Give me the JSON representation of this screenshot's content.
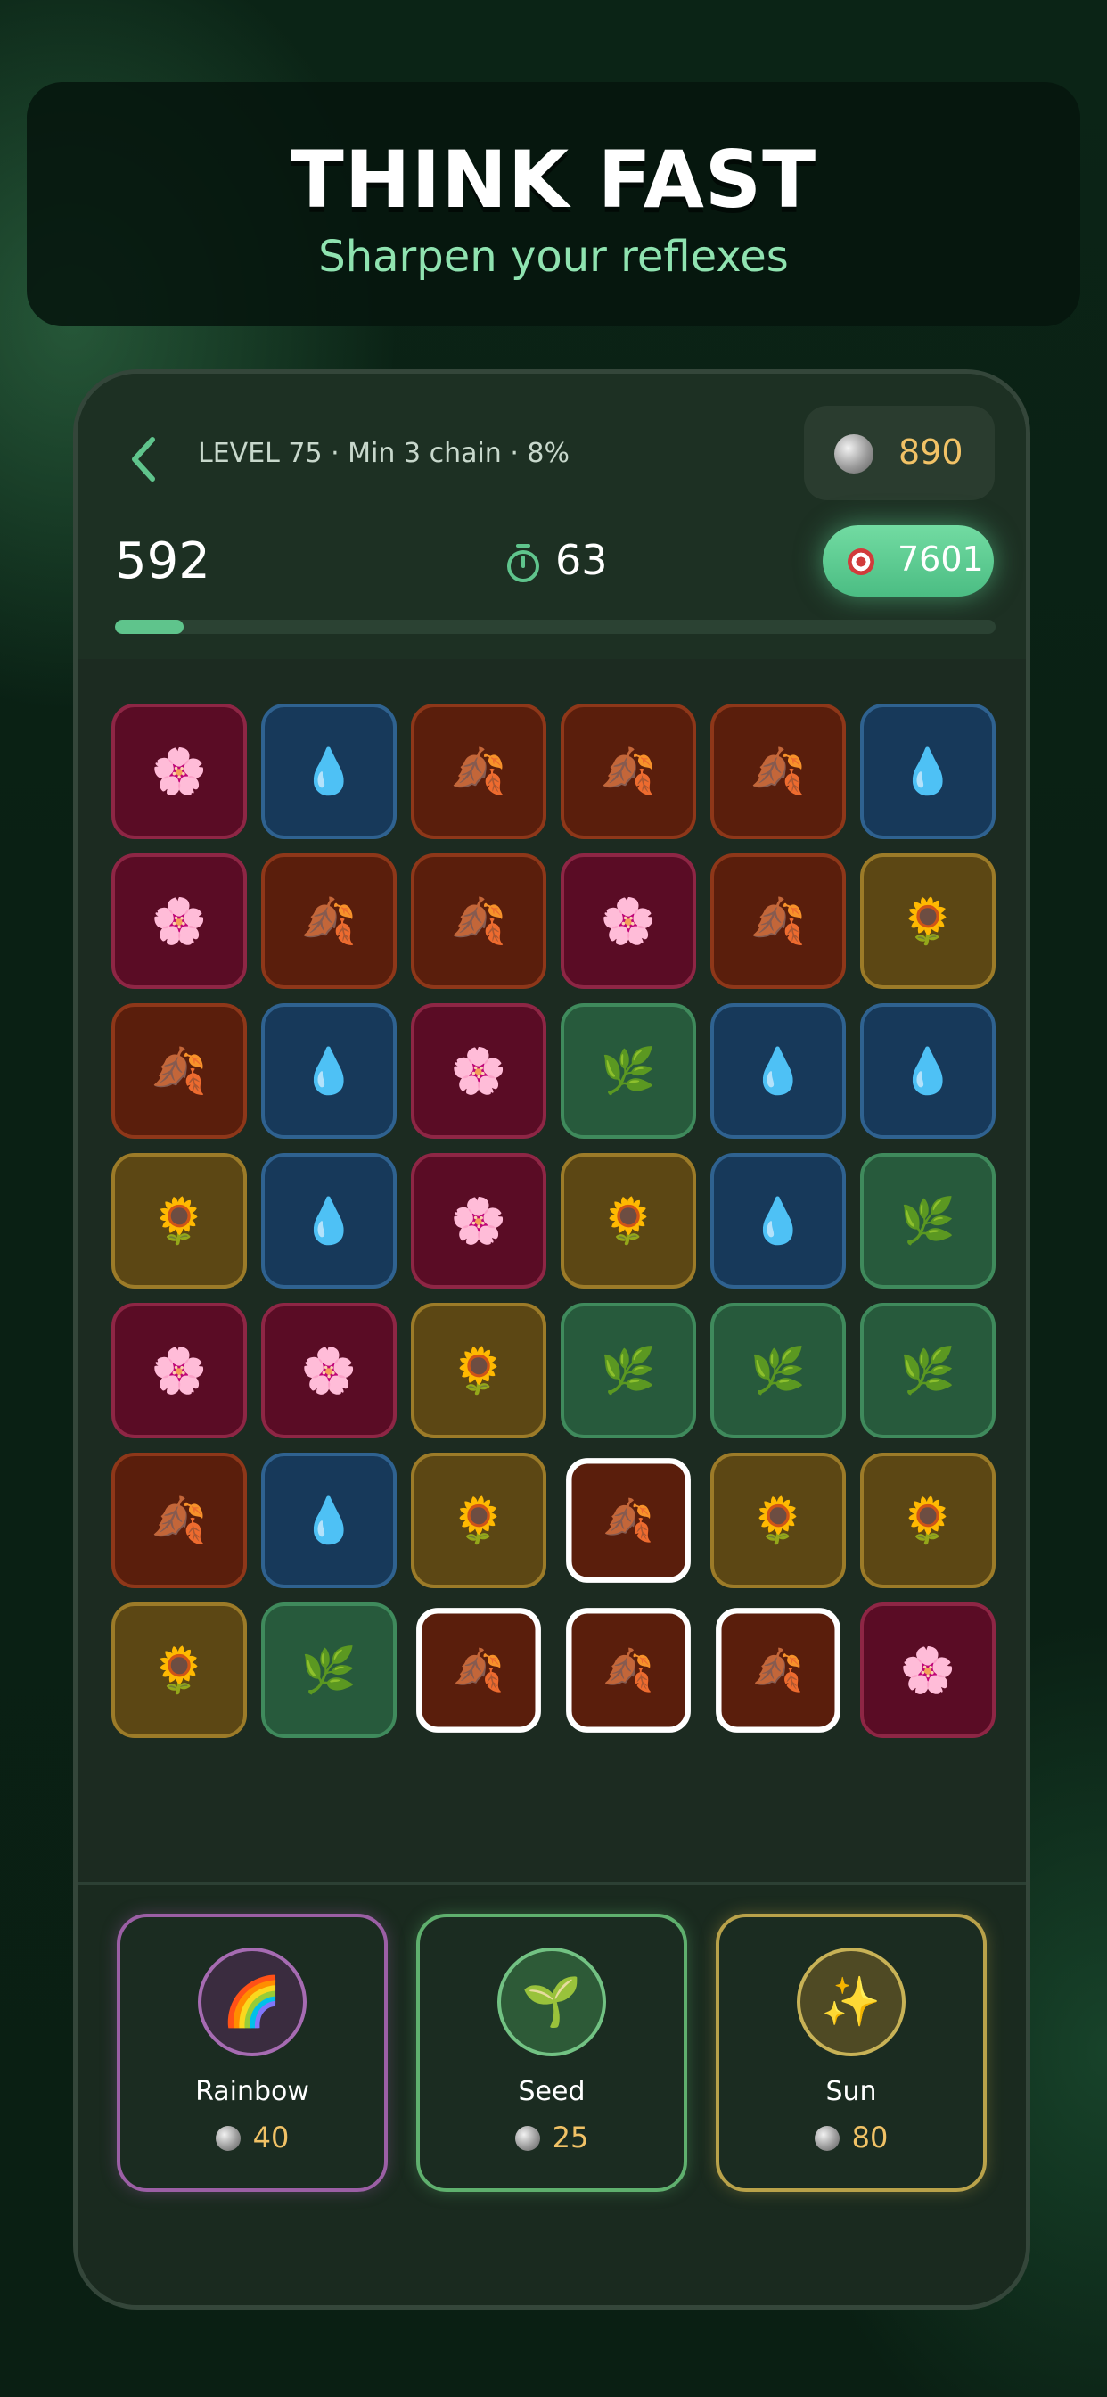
{
  "banner": {
    "title": "THINK FAST",
    "subtitle": "Sharpen your reflexes"
  },
  "header": {
    "level_label": "LEVEL 75 · Min 3 chain · 8%",
    "coins": "890",
    "score": "592",
    "timer": "63",
    "target": "7601",
    "progress_fraction": 0.078
  },
  "tile_types": {
    "flower": {
      "glyph": "🌸",
      "icon": "cherry-blossom-icon"
    },
    "drop": {
      "glyph": "💧",
      "icon": "water-drop-icon"
    },
    "leaf": {
      "glyph": "🍂",
      "icon": "fallen-leaf-icon"
    },
    "sun": {
      "glyph": "🌻",
      "icon": "sunflower-icon"
    },
    "herb": {
      "glyph": "🌿",
      "icon": "leaf-wind-icon"
    }
  },
  "board": [
    [
      "flower",
      "drop",
      "leaf",
      "leaf",
      "leaf",
      "drop"
    ],
    [
      "flower",
      "leaf",
      "leaf",
      "flower",
      "leaf",
      "sun"
    ],
    [
      "leaf",
      "drop",
      "flower",
      "herb",
      "drop",
      "drop"
    ],
    [
      "sun",
      "drop",
      "flower",
      "sun",
      "drop",
      "herb"
    ],
    [
      "flower",
      "flower",
      "sun",
      "herb",
      "herb",
      "herb"
    ],
    [
      "leaf",
      "drop",
      "sun",
      "leaf",
      "sun",
      "sun"
    ],
    [
      "sun",
      "herb",
      "leaf",
      "leaf",
      "leaf",
      "flower"
    ]
  ],
  "selected_cells": [
    [
      5,
      3
    ],
    [
      6,
      2
    ],
    [
      6,
      3
    ],
    [
      6,
      4
    ]
  ],
  "powerups": [
    {
      "id": "rainbow",
      "name": "Rainbow",
      "price": "40",
      "glyph": "🌈",
      "icon": "rainbow-icon"
    },
    {
      "id": "seed",
      "name": "Seed",
      "price": "25",
      "glyph": "🌱",
      "icon": "seedling-icon"
    },
    {
      "id": "sun",
      "name": "Sun",
      "price": "80",
      "glyph": "✨",
      "icon": "sparkles-icon"
    }
  ],
  "colors": {
    "accent_green": "#5fc48c",
    "coin_gold": "#f1c266",
    "flower_tile": "#5a0c25",
    "drop_tile": "#17395a",
    "leaf_tile": "#5a1e0c",
    "sun_tile": "#5c4714",
    "herb_tile": "#275a3c"
  }
}
